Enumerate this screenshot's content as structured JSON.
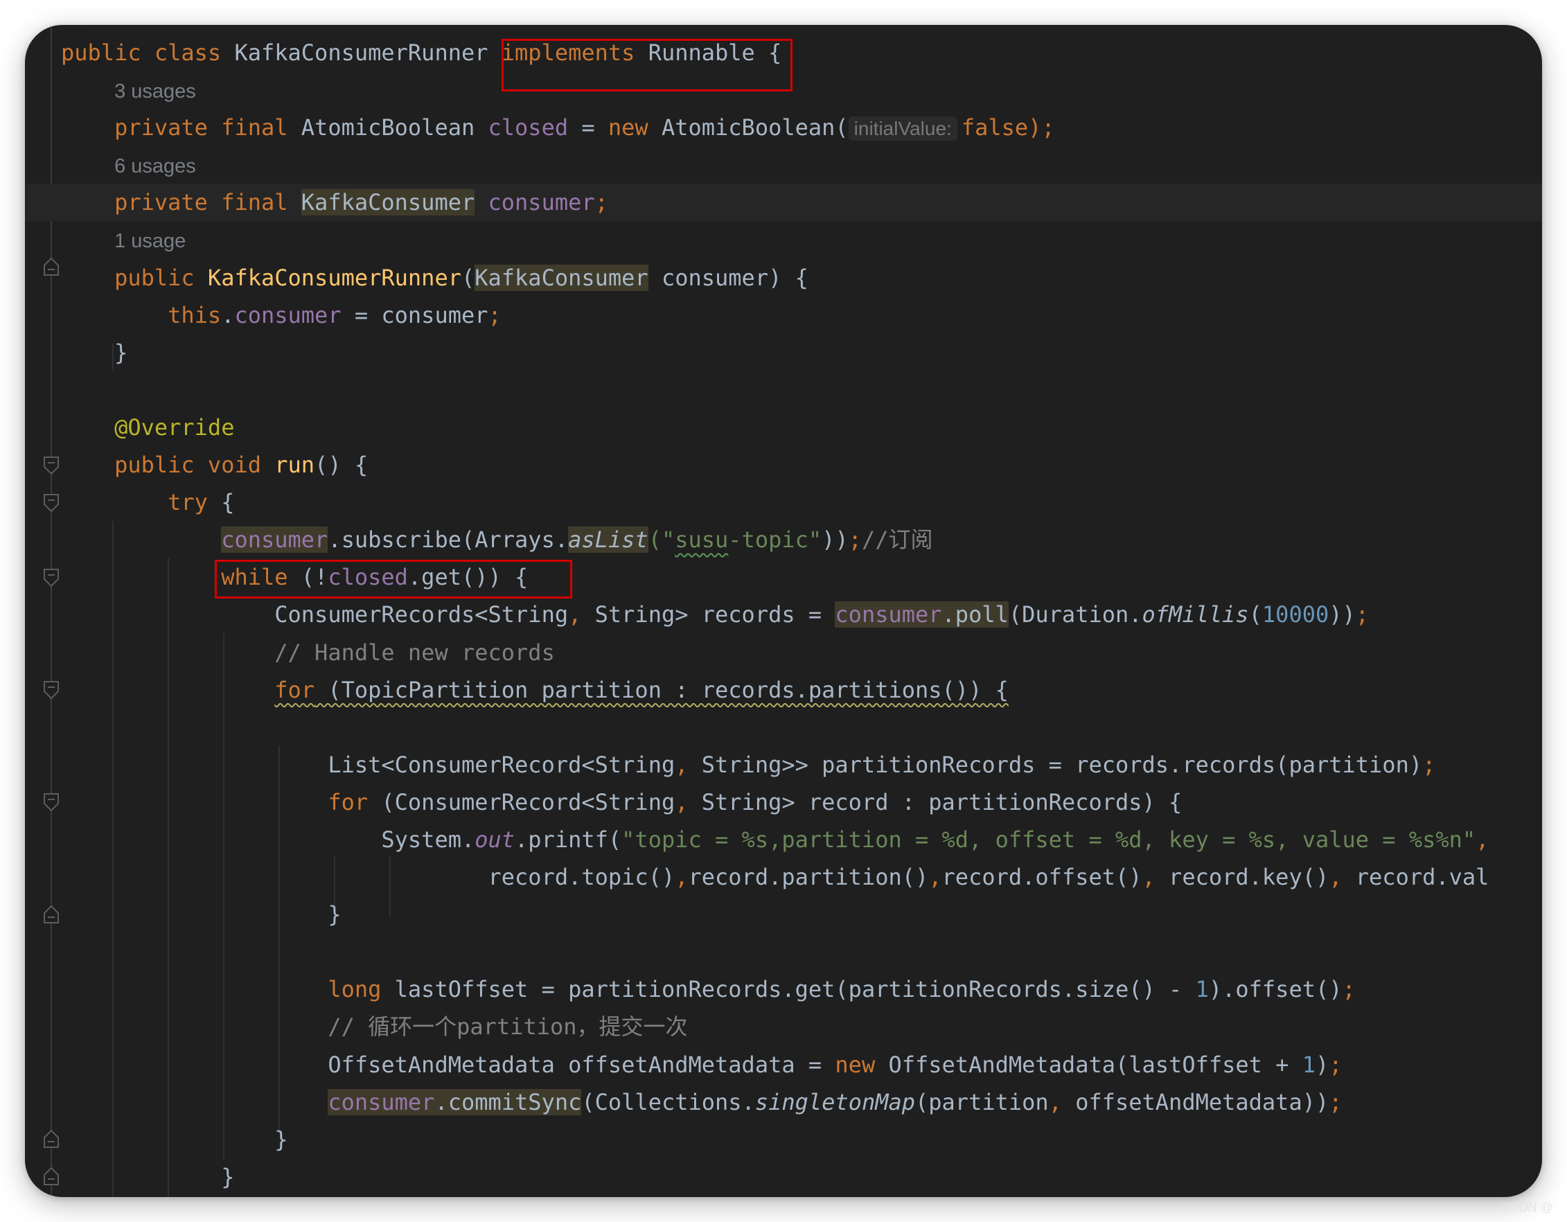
{
  "editor": {
    "usage_hints": {
      "closed": "3 usages",
      "consumer": "6 usages",
      "constructor": "1 usage"
    },
    "param_hint": "initialValue:",
    "highlight_boxes": [
      "implements Runnable",
      "while (!closed.get()) {"
    ],
    "lines": {
      "l1": [
        "public",
        "class",
        "KafkaConsumerRunner",
        "implements",
        "Runnable",
        "{"
      ],
      "l3": [
        "private",
        "final",
        "AtomicBoolean",
        "closed",
        "=",
        "new",
        "AtomicBoolean(",
        "false",
        ");"
      ],
      "l5": [
        "private",
        "final",
        "KafkaConsumer",
        "consumer",
        ";"
      ],
      "l7": [
        "public",
        "KafkaConsumerRunner",
        "(",
        "KafkaConsumer",
        "consumer) {"
      ],
      "l8": [
        "this",
        ".",
        "consumer",
        " = consumer",
        ";"
      ],
      "l9": [
        "}"
      ],
      "l11": [
        "@Override"
      ],
      "l12": [
        "public",
        "void",
        "run",
        "() {"
      ],
      "l13": [
        "try",
        "{"
      ],
      "l14": [
        "consumer",
        ".subscribe",
        "(Arrays.",
        "asList",
        "(\"",
        "susu",
        "-topic\"",
        "))",
        ";",
        "//订阅"
      ],
      "l15": [
        "while",
        "(!",
        "closed",
        ".get()) {"
      ],
      "l16": [
        "ConsumerRecords<String",
        ",",
        " String> records = ",
        "consumer",
        ".poll",
        "(Duration.",
        "ofMillis",
        "(",
        "10000",
        "))",
        ";"
      ],
      "l17": [
        "// Handle new records"
      ],
      "l18": [
        "for",
        " (TopicPartition partition : records.partitions()) {"
      ],
      "l20": [
        "List<ConsumerRecord<String",
        ",",
        " String>> partitionRecords = records.records(partition)",
        ";"
      ],
      "l21": [
        "for",
        " (ConsumerRecord<String",
        ",",
        " String> record : partitionRecords) {"
      ],
      "l22": [
        "System.",
        "out",
        ".printf(",
        "\"topic = %s,partition = %d, offset = %d, key = %s, value = %s%n\"",
        ","
      ],
      "l23": [
        "record.topic()",
        ",",
        "record.partition()",
        ",",
        "record.offset()",
        ",",
        " record.key()",
        ",",
        " record.val"
      ],
      "l24": [
        "}"
      ],
      "l26": [
        "long",
        " lastOffset = partitionRecords.get(partitionRecords.size() - ",
        "1",
        ").offset()",
        ";"
      ],
      "l27": [
        "// 循环一个partition，提交一次"
      ],
      "l28": [
        "OffsetAndMetadata offsetAndMetadata = ",
        "new",
        " OffsetAndMetadata(lastOffset + ",
        "1",
        ")",
        ";"
      ],
      "l29": [
        "consumer",
        ".commitSync",
        "(Collections.",
        "singletonMap",
        "(partition",
        ",",
        " offsetAndMetadata))",
        ";"
      ],
      "l30": [
        "}"
      ],
      "l31": [
        "}"
      ]
    }
  },
  "watermark": "CSDN @"
}
